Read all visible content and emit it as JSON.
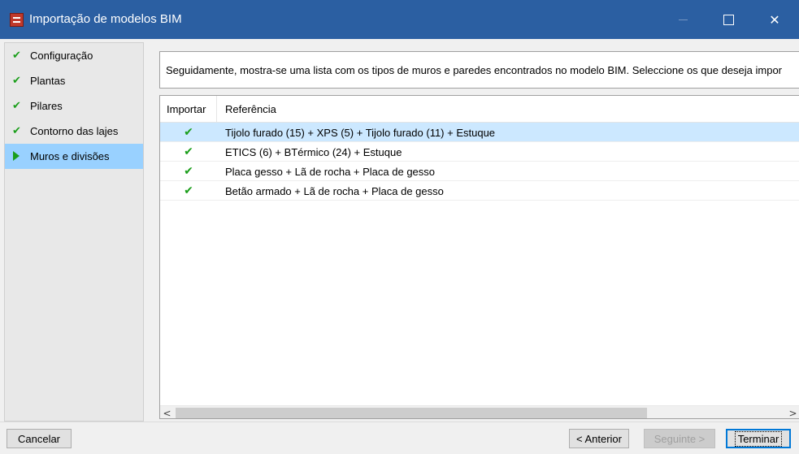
{
  "window": {
    "title": "Importação de modelos BIM",
    "close_glyph": "✕"
  },
  "sidebar": {
    "items": [
      {
        "label": "Configuração",
        "state": "done",
        "icon": "check-icon"
      },
      {
        "label": "Plantas",
        "state": "done",
        "icon": "check-icon"
      },
      {
        "label": "Pilares",
        "state": "done",
        "icon": "check-icon"
      },
      {
        "label": "Contorno das lajes",
        "state": "done",
        "icon": "check-icon"
      },
      {
        "label": "Muros e divisões",
        "state": "active",
        "icon": "arrow-right-icon"
      }
    ],
    "check_glyph": "✔"
  },
  "info": {
    "text": "Seguidamente, mostra-se uma lista com os tipos de muros e paredes encontrados no modelo BIM. Seleccione os que deseja impor"
  },
  "table": {
    "columns": [
      "Importar",
      "Referência"
    ],
    "check_glyph": "✔",
    "rows": [
      {
        "import": true,
        "reference": "Tijolo furado (15) + XPS (5) + Tijolo furado (11) + Estuque",
        "selected": true
      },
      {
        "import": true,
        "reference": "ETICS (6) + BTérmico (24) + Estuque",
        "selected": false
      },
      {
        "import": true,
        "reference": "Placa gesso + Lã de rocha + Placa de gesso",
        "selected": false
      },
      {
        "import": true,
        "reference": "Betão armado + Lã de rocha + Placa de gesso",
        "selected": false
      }
    ]
  },
  "scrollbar": {
    "left_glyph": "<",
    "right_glyph": ">"
  },
  "buttons": {
    "cancel": "Cancelar",
    "previous": "< Anterior",
    "next": "Seguinte >",
    "finish": "Terminar"
  },
  "colors": {
    "titlebar": "#2b5fa2",
    "active_step": "#99d1ff",
    "selected_row": "#cce8ff",
    "check": "#1a9e1a"
  }
}
